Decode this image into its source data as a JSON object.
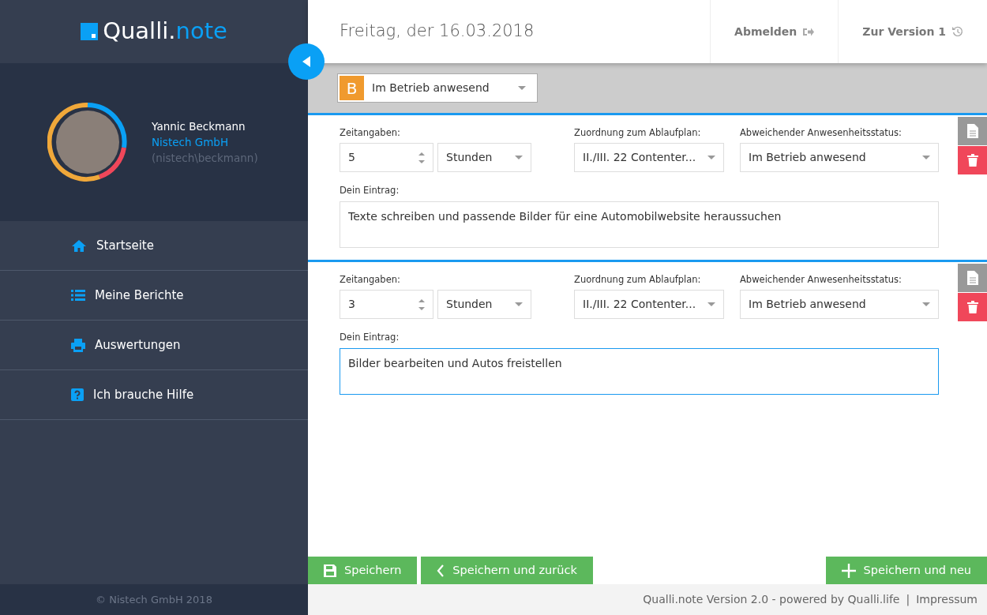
{
  "sidebar": {
    "logo": {
      "part_1": "Qualli.",
      "part_2": "note"
    },
    "profile": {
      "name": "Yannic Beckmann",
      "company": "Nistech GmbH",
      "account": "(nistech\\beckmann)"
    },
    "nav_items": [
      {
        "label": "Startseite",
        "kind": "home"
      },
      {
        "label": "Meine Berichte",
        "kind": "list"
      },
      {
        "label": "Auswertungen",
        "kind": "print"
      },
      {
        "label": "Ich brauche Hilfe",
        "kind": "help"
      }
    ],
    "footer": "© Nistech GmbH 2018"
  },
  "header": {
    "title": "Freitag, der 16.03.2018",
    "actions": [
      {
        "label": "Abmelden",
        "kind": "logout"
      },
      {
        "label": "Zur Version 1",
        "kind": "history"
      }
    ]
  },
  "status": {
    "badge": "B",
    "value": "Im Betrieb anwesend"
  },
  "entries": [
    {
      "time_label": "Zeitangaben:",
      "amount": "5",
      "unit": "Stunden",
      "plan_label": "Zuordnung zum Ablaufplan:",
      "plan": "II./III. 22 Contenter...",
      "status_label": "Abweichender Anwesenheitsstatus:",
      "status": "Im Betrieb anwesend",
      "entry_label": "Dein Eintrag:",
      "text": "Texte schreiben und passende Bilder für eine Automobilwebsite heraussuchen",
      "focused": false
    },
    {
      "time_label": "Zeitangaben:",
      "amount": "3",
      "unit": "Stunden",
      "plan_label": "Zuordnung zum Ablaufplan:",
      "plan": "II./III. 22 Contenter...",
      "status_label": "Abweichender Anwesenheitsstatus:",
      "status": "Im Betrieb anwesend",
      "entry_label": "Dein Eintrag:",
      "text": "Bilder bearbeiten und Autos freistellen",
      "focused": true
    }
  ],
  "buttons": [
    {
      "label": "Speichern",
      "kind": "save"
    },
    {
      "label": "Speichern und zurück",
      "kind": "back"
    },
    {
      "label": "Speichern und neu",
      "kind": "plus"
    }
  ],
  "footer": {
    "text": "Qualli.note Version 2.0 - powered by Qualli.life",
    "separator": "|",
    "link": "Impressum"
  }
}
